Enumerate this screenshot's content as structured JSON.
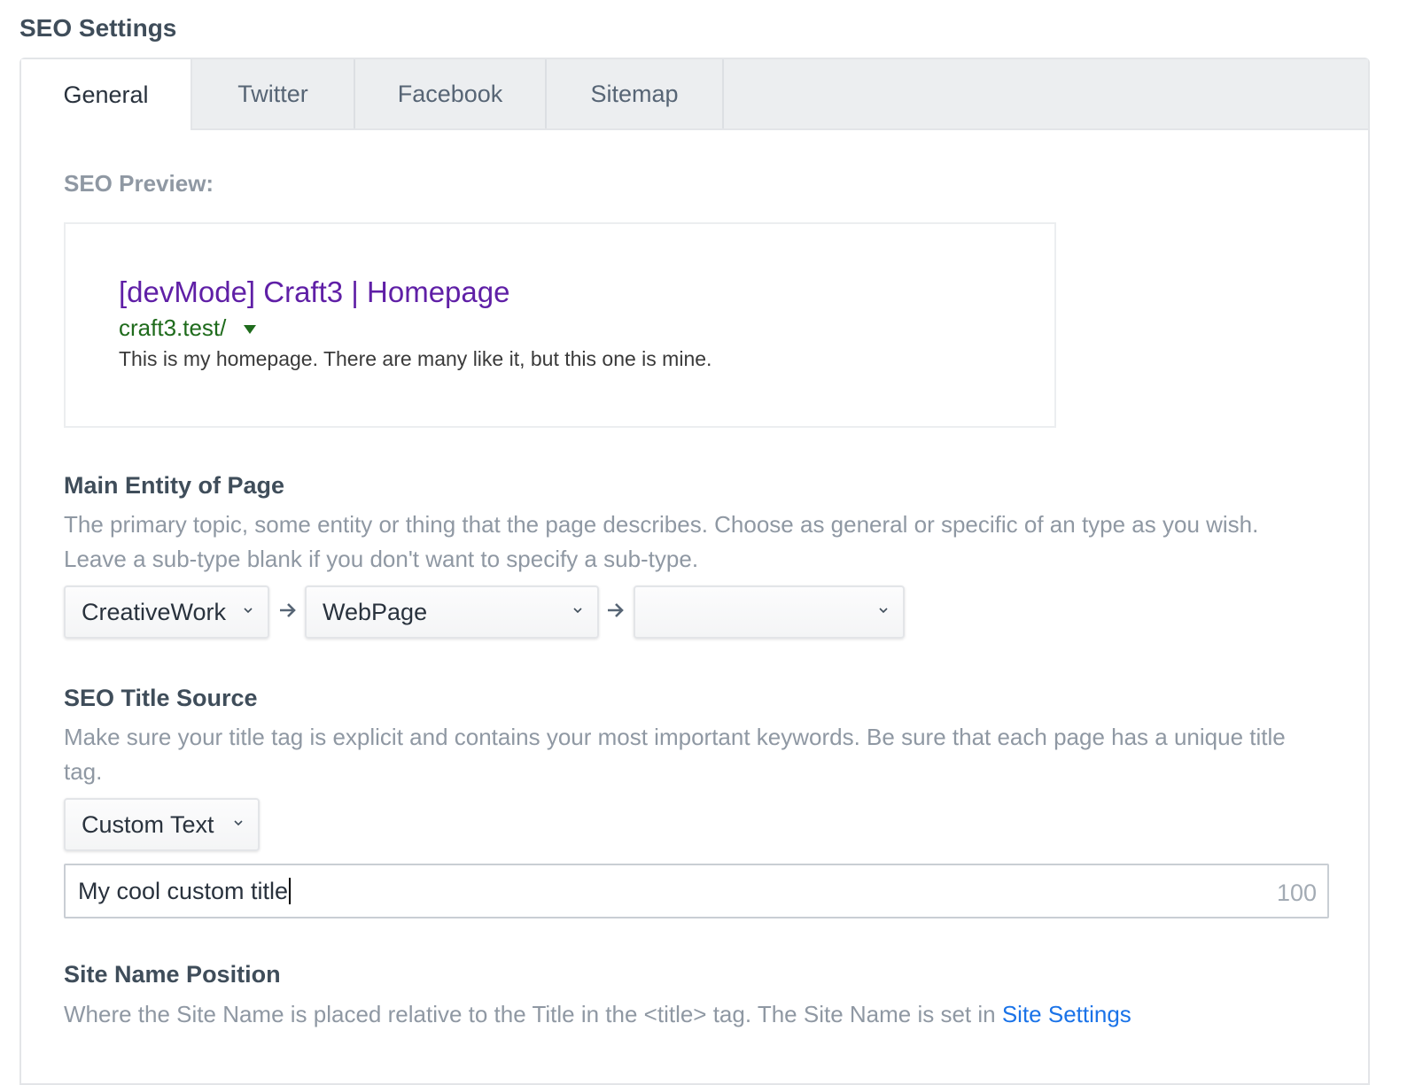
{
  "page": {
    "title": "SEO Settings"
  },
  "tabs": [
    {
      "label": "General",
      "active": true
    },
    {
      "label": "Twitter",
      "active": false
    },
    {
      "label": "Facebook",
      "active": false
    },
    {
      "label": "Sitemap",
      "active": false
    }
  ],
  "seo_preview": {
    "label": "SEO Preview:",
    "title": "[devMode] Craft3 | Homepage",
    "url": "craft3.test/",
    "description": "This is my homepage. There are many like it, but this one is mine."
  },
  "main_entity": {
    "heading": "Main Entity of Page",
    "instructions": "The primary topic, some entity or thing that the page describes. Choose as general or specific of an type as you wish. Leave a sub-type blank if you don't want to specify a sub-type.",
    "type_select": "CreativeWork",
    "subtype_select": "WebPage",
    "subsubtype_select": ""
  },
  "title_source": {
    "heading": "SEO Title Source",
    "instructions": "Make sure your title tag is explicit and contains your most important keywords. Be sure that each page has a unique title tag.",
    "source_select": "Custom Text",
    "custom_text_value": "My cool custom title",
    "char_count": "100"
  },
  "site_name_position": {
    "heading": "Site Name Position",
    "instructions_prefix": "Where the Site Name is placed relative to the Title in the <title> tag. The Site Name is set in ",
    "link_text": "Site Settings"
  },
  "colors": {
    "preview_title": "#5f1fa6",
    "preview_url": "#1f6b1c",
    "link": "#1a73e8",
    "muted_text": "#8f98a3",
    "tabbar_bg": "#eceef0"
  },
  "icons": {
    "select_caret": "chevron-down-icon",
    "entity_separator": "arrow-right-icon",
    "url_dropdown": "triangle-down-icon"
  }
}
